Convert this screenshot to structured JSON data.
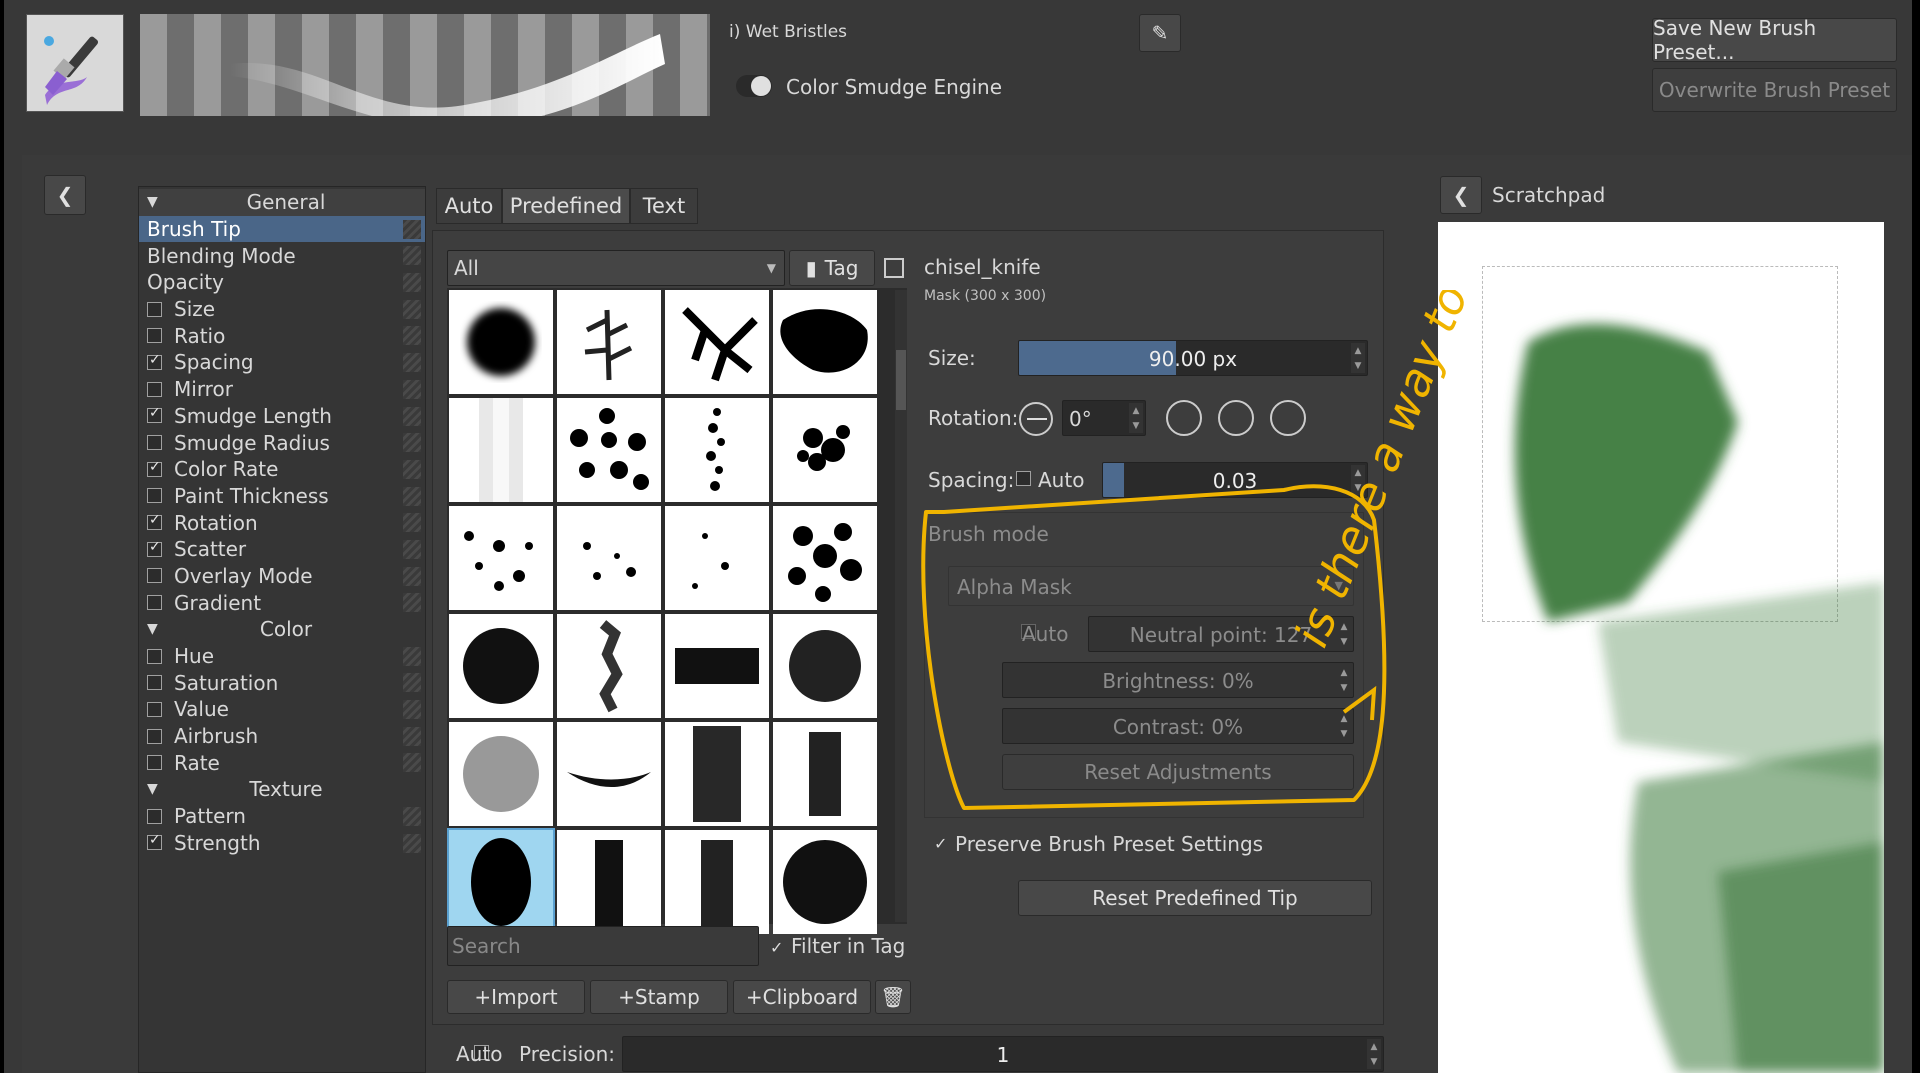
{
  "header": {
    "preset_name": "i) Wet Bristles",
    "engine_label": "Color Smudge Engine",
    "save_new_label": "Save New Brush Preset...",
    "overwrite_label": "Overwrite Brush Preset"
  },
  "categories": {
    "general": "General",
    "color": "Color",
    "texture": "Texture",
    "items": [
      {
        "label": "Brush Tip",
        "checked": null
      },
      {
        "label": "Blending Mode",
        "checked": null
      },
      {
        "label": "Opacity",
        "checked": null
      },
      {
        "label": "Size",
        "checked": false
      },
      {
        "label": "Ratio",
        "checked": false
      },
      {
        "label": "Spacing",
        "checked": true
      },
      {
        "label": "Mirror",
        "checked": false
      },
      {
        "label": "Smudge Length",
        "checked": true
      },
      {
        "label": "Smudge Radius",
        "checked": false
      },
      {
        "label": "Color Rate",
        "checked": true
      },
      {
        "label": "Paint Thickness",
        "checked": false
      },
      {
        "label": "Rotation",
        "checked": true
      },
      {
        "label": "Scatter",
        "checked": true
      },
      {
        "label": "Overlay Mode",
        "checked": false
      },
      {
        "label": "Gradient",
        "checked": false
      }
    ],
    "color_items": [
      {
        "label": "Hue",
        "checked": false
      },
      {
        "label": "Saturation",
        "checked": false
      },
      {
        "label": "Value",
        "checked": false
      },
      {
        "label": "Airbrush",
        "checked": false
      },
      {
        "label": "Rate",
        "checked": false
      }
    ],
    "texture_items": [
      {
        "label": "Pattern",
        "checked": false
      },
      {
        "label": "Strength",
        "checked": true
      }
    ]
  },
  "tip_tabs": {
    "auto": "Auto",
    "predefined": "Predefined",
    "text": "Text"
  },
  "filter": {
    "value": "All",
    "tag_label": "Tag"
  },
  "search": {
    "placeholder": "Search",
    "filter_in_tag": "Filter in Tag"
  },
  "actions": {
    "import": "+Import",
    "stamp": "+Stamp",
    "clipboard": "+Clipboard"
  },
  "tip": {
    "name": "chisel_knife",
    "info": "Mask (300 x 300)"
  },
  "params": {
    "size_label": "Size:",
    "size_value": "90.00 px",
    "size_fraction": 0.45,
    "rotation_label": "Rotation:",
    "rotation_value": "0°",
    "spacing_label": "Spacing:",
    "spacing_auto": "Auto",
    "spacing_value": "0.03",
    "spacing_fraction": 0.08
  },
  "brush_mode": {
    "title": "Brush mode",
    "mode_value": "Alpha Mask",
    "auto_label": "Auto",
    "neutral_point": "Neutral point: 127",
    "brightness": "Brightness: 0%",
    "contrast": "Contrast: 0%",
    "reset_adjustments": "Reset Adjustments"
  },
  "preserve_label": "Preserve Brush Preset Settings",
  "reset_tip_label": "Reset Predefined Tip",
  "precision": {
    "auto": "Auto",
    "label": "Precision:",
    "value": "1"
  },
  "scratchpad": {
    "title": "Scratchpad"
  },
  "annotation": {
    "text": "is there a way to activate this??"
  },
  "colors": {
    "accent": "#4a6688",
    "annotation": "#f0b400",
    "paint": "#3d7a3d"
  }
}
